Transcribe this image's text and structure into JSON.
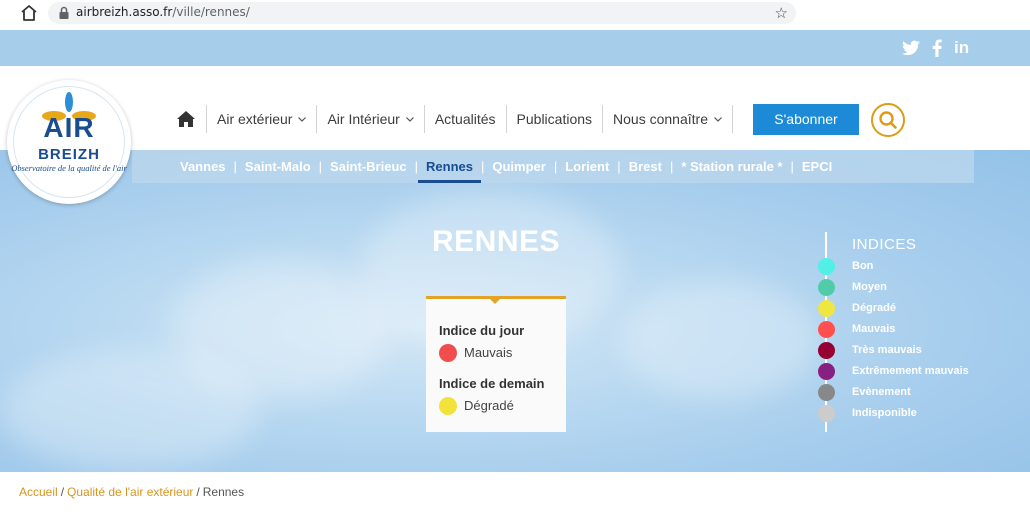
{
  "browser": {
    "url_host": "airbreizh.asso.fr",
    "url_path": "/ville/rennes/",
    "icons": [
      "home-icon",
      "lock-icon",
      "star-icon"
    ]
  },
  "social": {
    "icons": [
      "twitter-icon",
      "facebook-icon",
      "linkedin-icon"
    ],
    "linkedin_glyph": "in"
  },
  "logo": {
    "name_top": "AIR",
    "name_bottom": "BREIZH",
    "tagline": "Observatoire de la qualité de l'air"
  },
  "nav": {
    "items": [
      {
        "label": "Air extérieur",
        "has_dropdown": true
      },
      {
        "label": "Air Intérieur",
        "has_dropdown": true
      },
      {
        "label": "Actualités",
        "has_dropdown": false
      },
      {
        "label": "Publications",
        "has_dropdown": false
      },
      {
        "label": "Nous connaître",
        "has_dropdown": true
      }
    ],
    "subscribe_label": "S'abonner"
  },
  "cities": {
    "items": [
      "Vannes",
      "Saint-Malo",
      "Saint-Brieuc",
      "Rennes",
      "Quimper",
      "Lorient",
      "Brest",
      "* Station rurale *",
      "EPCI"
    ],
    "active": "Rennes"
  },
  "page": {
    "title": "RENNES"
  },
  "index_card": {
    "today_label": "Indice du jour",
    "today_value": "Mauvais",
    "today_color": "#f04e4e",
    "tomorrow_label": "Indice de demain",
    "tomorrow_value": "Dégradé",
    "tomorrow_color": "#f2e33a"
  },
  "legend": {
    "title": "INDICES",
    "items": [
      {
        "label": "Bon",
        "color": "#50f0e6"
      },
      {
        "label": "Moyen",
        "color": "#50ccaa"
      },
      {
        "label": "Dégradé",
        "color": "#f0e641"
      },
      {
        "label": "Mauvais",
        "color": "#ff5050"
      },
      {
        "label": "Très mauvais",
        "color": "#960032"
      },
      {
        "label": "Extrêmement mauvais",
        "color": "#872181"
      },
      {
        "label": "Evènement",
        "color": "#888888"
      },
      {
        "label": "Indisponible",
        "color": "#cccccc"
      }
    ]
  },
  "breadcrumb": {
    "items": [
      "Accueil",
      "Qualité de l'air extérieur",
      "Rennes"
    ],
    "separator": "/"
  },
  "colors": {
    "brand_blue": "#1a4d8f",
    "accent_orange": "#e09b14",
    "subscribe_blue": "#1c8ad6",
    "sky": "#a6cdea"
  }
}
